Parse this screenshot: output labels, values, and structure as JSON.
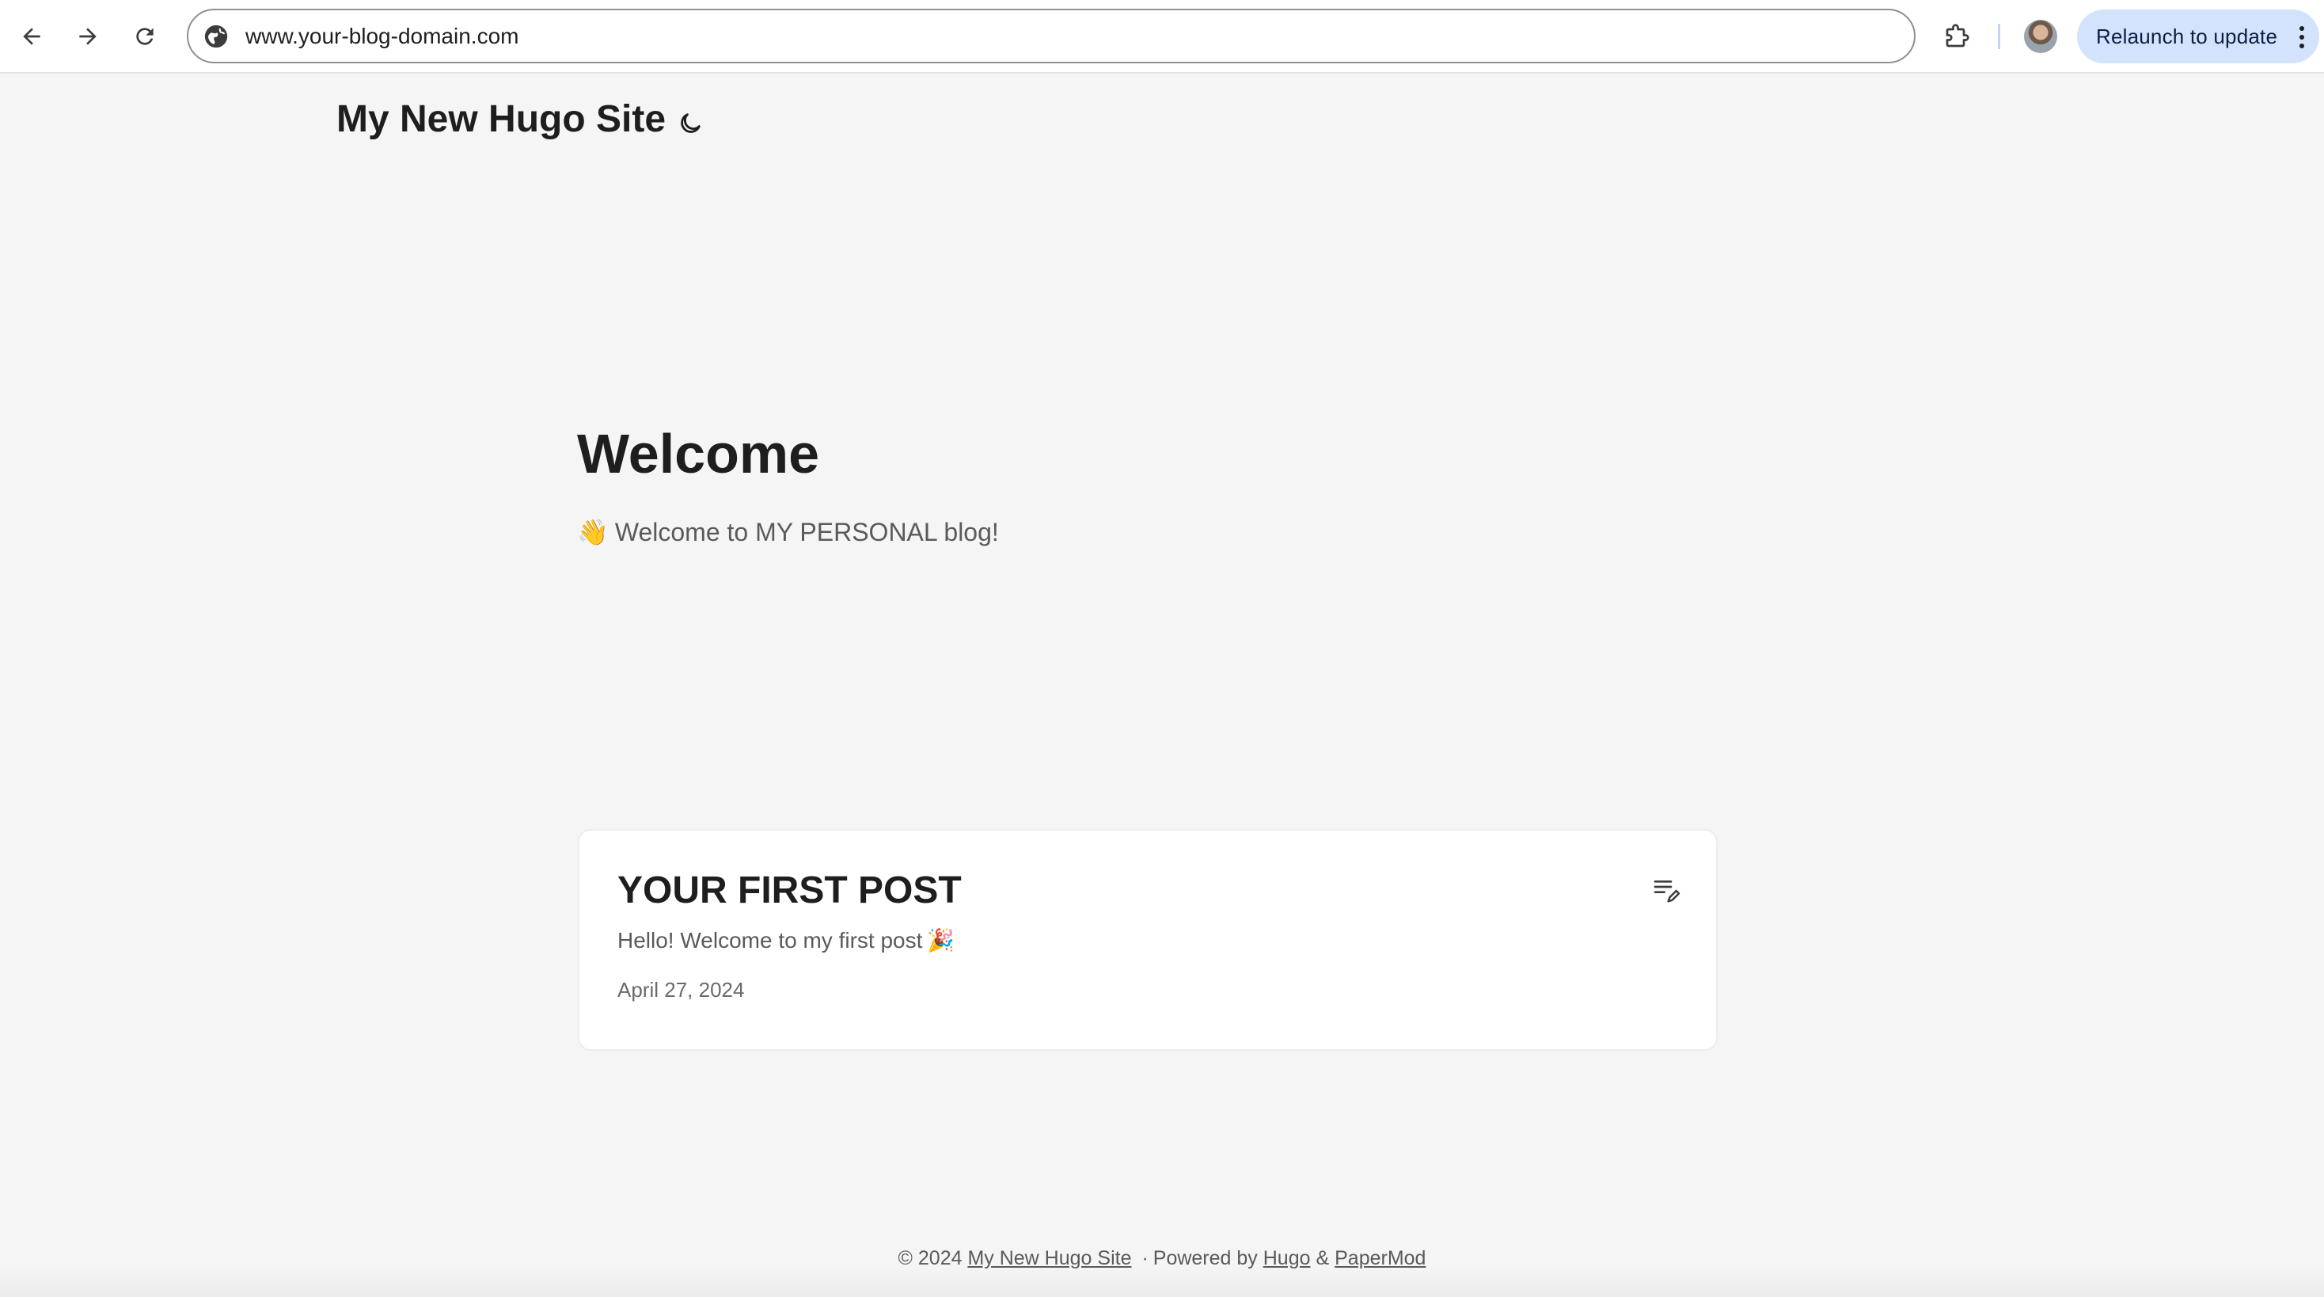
{
  "browser": {
    "url": "www.your-blog-domain.com",
    "relaunch_label": "Relaunch to update",
    "icons": {
      "back": "back-arrow-icon",
      "forward": "forward-arrow-icon",
      "reload": "reload-icon",
      "site_info": "site-info-icon",
      "extensions": "puzzle-piece-icon",
      "menu": "kebab-menu-icon"
    },
    "colors": {
      "relaunch_bg": "#d3e3fd",
      "omnibox_border": "#8e918f"
    }
  },
  "header": {
    "site_title": "My New Hugo Site",
    "theme_toggle_icon": "moon-icon"
  },
  "home_info": {
    "title": "Welcome",
    "emoji": "👋",
    "subtitle": "Welcome to MY PERSONAL blog!"
  },
  "posts": [
    {
      "title": "YOUR FIRST POST",
      "excerpt": "Hello! Welcome to my first post",
      "excerpt_emoji": "🎉",
      "date": "April 27, 2024",
      "icon": "edit-note-icon"
    }
  ],
  "footer": {
    "copyright": "© 2024",
    "site_link": "My New Hugo Site",
    "separator": "·",
    "powered_by": "Powered by",
    "hugo_link": "Hugo",
    "ampersand": "&",
    "theme_link": "PaperMod"
  }
}
